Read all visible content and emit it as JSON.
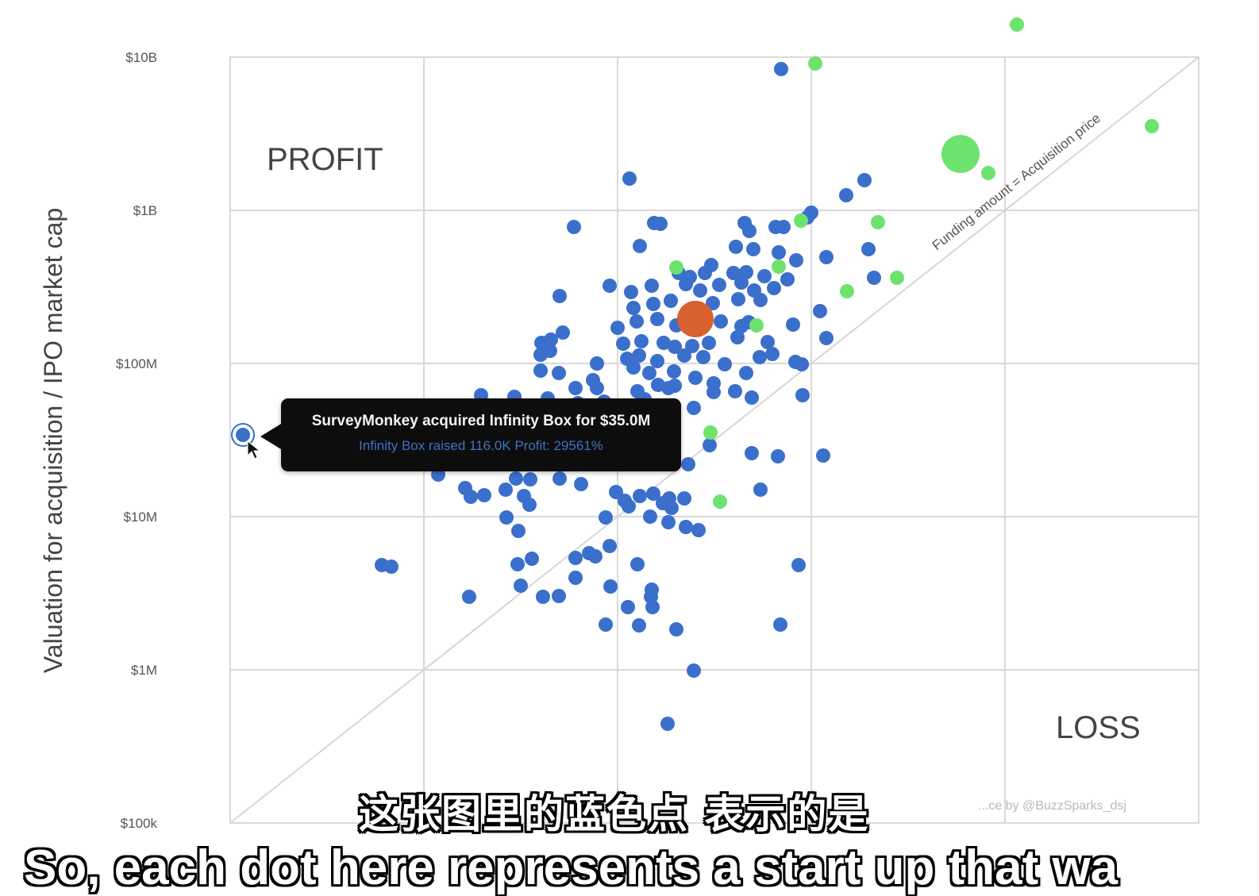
{
  "chart_data": {
    "type": "scatter",
    "y_axis": {
      "label": "Valuation for acquisition / IPO market cap",
      "scale": "log",
      "ticks": [
        "$100k",
        "$1M",
        "$10M",
        "$100M",
        "$1B",
        "$10B"
      ],
      "range": [
        "$100k",
        "$10B"
      ]
    },
    "grid": true,
    "regions": {
      "upper_left": "PROFIT",
      "lower_right": "LOSS"
    },
    "diagonal_label": "Funding amount = Acquisition price",
    "credit": "...ce by @BuzzSparks_dsj",
    "colors": {
      "blue": "#3a6fcc",
      "green": "#6de36d",
      "highlight": "#d9602f",
      "grid": "#d9d9d9"
    },
    "series": [
      {
        "color": "blue",
        "points": [
          [
            984,
            87
          ],
          [
            793,
            225
          ],
          [
            1089,
            227
          ],
          [
            1066,
            246
          ],
          [
            1022,
            268
          ],
          [
            1017,
            274
          ],
          [
            723,
            286
          ],
          [
            824,
            281
          ],
          [
            832,
            282
          ],
          [
            938,
            281
          ],
          [
            944,
            291
          ],
          [
            977,
            286
          ],
          [
            987,
            286
          ],
          [
            806,
            310
          ],
          [
            927,
            311
          ],
          [
            949,
            314
          ],
          [
            981,
            318
          ],
          [
            1003,
            328
          ],
          [
            1041,
            324
          ],
          [
            1094,
            314
          ],
          [
            896,
            334
          ],
          [
            855,
            344
          ],
          [
            869,
            349
          ],
          [
            888,
            344
          ],
          [
            924,
            344
          ],
          [
            940,
            343
          ],
          [
            963,
            348
          ],
          [
            992,
            352
          ],
          [
            1101,
            350
          ],
          [
            768,
            360
          ],
          [
            795,
            368
          ],
          [
            821,
            360
          ],
          [
            864,
            358
          ],
          [
            882,
            366
          ],
          [
            906,
            359
          ],
          [
            934,
            356
          ],
          [
            950,
            366
          ],
          [
            975,
            363
          ],
          [
            705,
            373
          ],
          [
            798,
            388
          ],
          [
            823,
            383
          ],
          [
            845,
            379
          ],
          [
            898,
            382
          ],
          [
            930,
            377
          ],
          [
            958,
            378
          ],
          [
            1033,
            392
          ],
          [
            778,
            413
          ],
          [
            802,
            405
          ],
          [
            828,
            402
          ],
          [
            852,
            410
          ],
          [
            908,
            405
          ],
          [
            934,
            411
          ],
          [
            943,
            406
          ],
          [
            999,
            409
          ],
          [
            682,
            432
          ],
          [
            694,
            428
          ],
          [
            709,
            419
          ],
          [
            785,
            433
          ],
          [
            808,
            430
          ],
          [
            836,
            432
          ],
          [
            850,
            437
          ],
          [
            872,
            436
          ],
          [
            893,
            432
          ],
          [
            929,
            425
          ],
          [
            967,
            431
          ],
          [
            1041,
            426
          ],
          [
            681,
            447
          ],
          [
            693,
            442
          ],
          [
            752,
            458
          ],
          [
            790,
            452
          ],
          [
            805,
            448
          ],
          [
            828,
            455
          ],
          [
            862,
            448
          ],
          [
            886,
            450
          ],
          [
            913,
            459
          ],
          [
            957,
            450
          ],
          [
            973,
            446
          ],
          [
            1010,
            459
          ],
          [
            681,
            467
          ],
          [
            704,
            470
          ],
          [
            747,
            479
          ],
          [
            798,
            463
          ],
          [
            818,
            470
          ],
          [
            849,
            468
          ],
          [
            876,
            476
          ],
          [
            899,
            483
          ],
          [
            940,
            470
          ],
          [
            1002,
            456
          ],
          [
            725,
            489
          ],
          [
            752,
            489
          ],
          [
            803,
            493
          ],
          [
            829,
            485
          ],
          [
            842,
            489
          ],
          [
            850,
            486
          ],
          [
            899,
            494
          ],
          [
            926,
            493
          ],
          [
            947,
            501
          ],
          [
            1011,
            498
          ],
          [
            606,
            498
          ],
          [
            648,
            500
          ],
          [
            690,
            502
          ],
          [
            728,
            508
          ],
          [
            761,
            506
          ],
          [
            812,
            503
          ],
          [
            874,
            514
          ],
          [
            552,
            598
          ],
          [
            586,
            615
          ],
          [
            593,
            626
          ],
          [
            610,
            624
          ],
          [
            637,
            617
          ],
          [
            650,
            603
          ],
          [
            668,
            604
          ],
          [
            705,
            603
          ],
          [
            732,
            610
          ],
          [
            776,
            620
          ],
          [
            806,
            625
          ],
          [
            823,
            622
          ],
          [
            835,
            634
          ],
          [
            846,
            640
          ],
          [
            660,
            625
          ],
          [
            638,
            652
          ],
          [
            667,
            636
          ],
          [
            787,
            631
          ],
          [
            792,
            638
          ],
          [
            843,
            628
          ],
          [
            862,
            628
          ],
          [
            867,
            585
          ],
          [
            894,
            561
          ],
          [
            947,
            571
          ],
          [
            980,
            575
          ],
          [
            1037,
            574
          ],
          [
            958,
            617
          ],
          [
            653,
            669
          ],
          [
            763,
            652
          ],
          [
            819,
            651
          ],
          [
            842,
            658
          ],
          [
            864,
            664
          ],
          [
            880,
            668
          ],
          [
            725,
            703
          ],
          [
            742,
            697
          ],
          [
            750,
            701
          ],
          [
            768,
            688
          ],
          [
            652,
            711
          ],
          [
            670,
            704
          ],
          [
            803,
            711
          ],
          [
            1006,
            712
          ],
          [
            481,
            712
          ],
          [
            493,
            714
          ],
          [
            591,
            752
          ],
          [
            656,
            738
          ],
          [
            684,
            752
          ],
          [
            704,
            751
          ],
          [
            725,
            728
          ],
          [
            769,
            739
          ],
          [
            821,
            743
          ],
          [
            820,
            752
          ],
          [
            822,
            765
          ],
          [
            791,
            765
          ],
          [
            763,
            787
          ],
          [
            805,
            788
          ],
          [
            852,
            793
          ],
          [
            983,
            787
          ],
          [
            874,
            845
          ],
          [
            841,
            912
          ],
          [
            306,
            548
          ]
        ]
      },
      {
        "color": "green",
        "points": [
          [
            1281,
            31
          ],
          [
            1027,
            80
          ],
          [
            1245,
            218
          ],
          [
            1451,
            159
          ],
          [
            1106,
            280
          ],
          [
            1009,
            278
          ],
          [
            1130,
            350
          ],
          [
            1067,
            367
          ],
          [
            852,
            337
          ],
          [
            981,
            336
          ],
          [
            953,
            410
          ],
          [
            895,
            545
          ],
          [
            907,
            632
          ]
        ]
      },
      {
        "color": "green",
        "size": "large",
        "points": [
          [
            1210,
            194
          ]
        ]
      },
      {
        "color": "highlight",
        "size": "large",
        "points": [
          [
            876,
            402
          ]
        ]
      }
    ]
  },
  "tooltip": {
    "title": "SurveyMonkey acquired Infinity Box for $35.0M",
    "detail": "Infinity Box raised 116.0K Profit: 29561%"
  },
  "subtitles": {
    "chinese": "这张图里的蓝色点 表示的是",
    "english": "So, each dot here represents a start up that wa"
  }
}
